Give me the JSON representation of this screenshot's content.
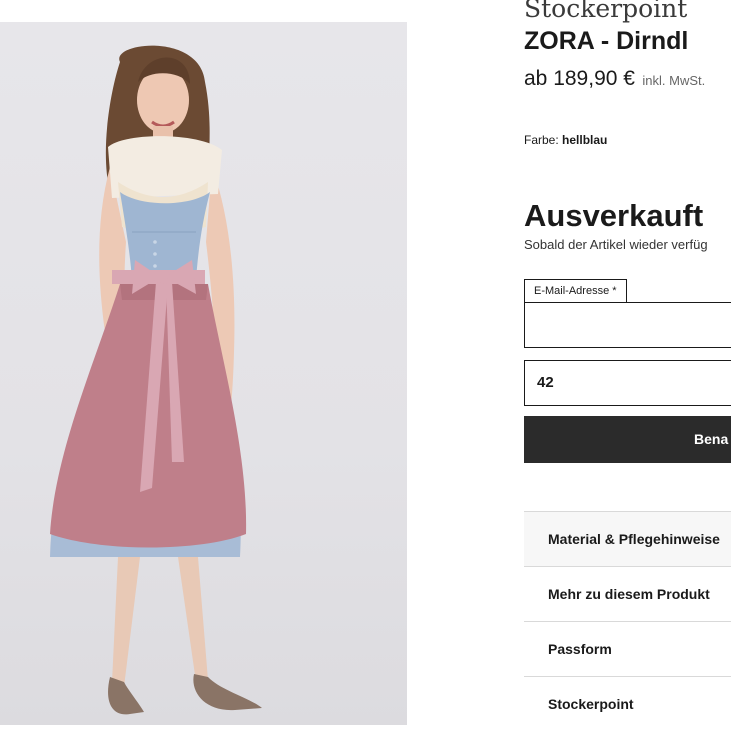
{
  "product": {
    "brand": "Stockerpoint",
    "name": "ZORA - Dirndl",
    "price": "ab 189,90 €",
    "vat_note": "inkl. MwSt.",
    "color_label": "Farbe:",
    "color_value": "hellblau"
  },
  "availability": {
    "status": "Ausverkauft",
    "notice": "Sobald der Artikel wieder verfüg"
  },
  "form": {
    "email_label": "E-Mail-Adresse *",
    "email_value": "",
    "size_value": "42",
    "submit_label": "Bena"
  },
  "accordion": [
    {
      "label": "Material & Pflegehinweise"
    },
    {
      "label": "Mehr zu diesem Produkt"
    },
    {
      "label": "Passform"
    },
    {
      "label": "Stockerpoint"
    }
  ],
  "colors": {
    "background": "#ffffff",
    "button": "#2b2b2b",
    "bodice": "#9fb6d2",
    "apron": "#bf7f8a",
    "sash": "#d9a7b3"
  }
}
